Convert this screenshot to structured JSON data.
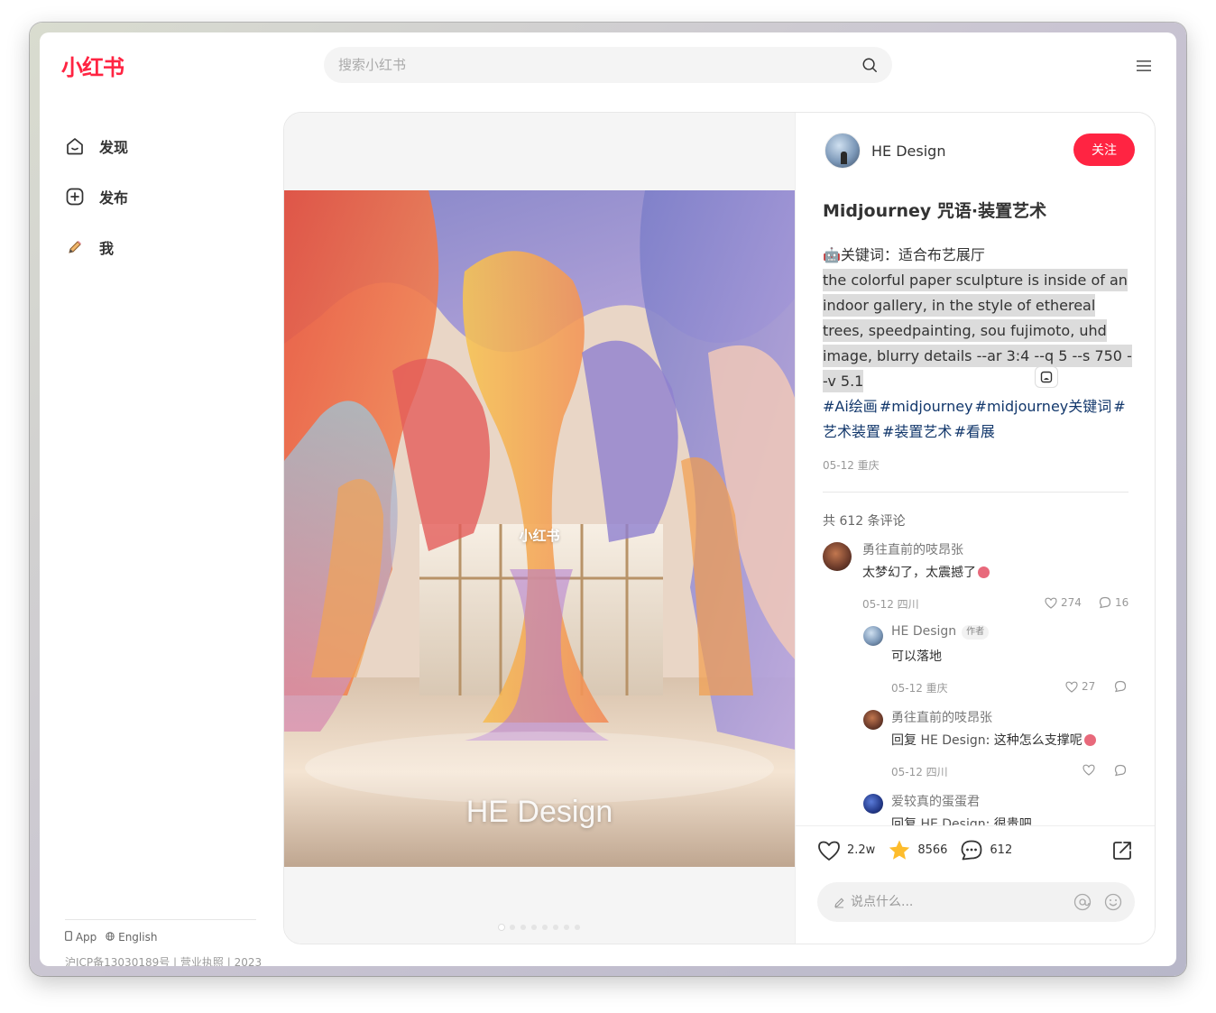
{
  "header": {
    "logo": "小红书",
    "search_placeholder": "搜索小红书"
  },
  "nav": {
    "items": [
      {
        "label": "发现",
        "icon": "home-icon"
      },
      {
        "label": "发布",
        "icon": "plus-square-icon"
      },
      {
        "label": "我",
        "icon": "pencil-avatar-icon"
      }
    ]
  },
  "footer": {
    "app": "App",
    "language": "English",
    "icp": "沪ICP备13030189号 | 营业执照 | 2023"
  },
  "media": {
    "watermark": "小红书",
    "brand_text": "HE Design",
    "image_count": 8,
    "active_index": 0
  },
  "note": {
    "author": "HE Design",
    "follow_label": "关注",
    "title": "Midjourney 咒语·装置艺术",
    "keyword_line": "🤖关键词：适合布艺展厅",
    "prompt": "the colorful paper sculpture is inside of an indoor gallery, in the style of ethereal trees, speedpainting, sou fujimoto, uhd image, blurry details --ar 3:4 --q 5 --s 750 --v 5.1",
    "tags": [
      "#Ai绘画",
      "#midjourney",
      "#midjourney关键词",
      "#艺术装置",
      "#装置艺术",
      "#看展"
    ],
    "date_location": "05-12 重庆",
    "comment_count_text": "共 612 条评论"
  },
  "comments": [
    {
      "name": "勇往直前的吱昂张",
      "text": "太梦幻了，太震撼了",
      "meta": "05-12 四川",
      "likes": "274",
      "replies": "16"
    },
    {
      "name": "HE Design",
      "tag": "作者",
      "text": "可以落地",
      "meta": "05-12 重庆",
      "likes": "27",
      "replies": ""
    },
    {
      "name": "勇往直前的吱昂张",
      "text_prefix": "回复",
      "text_target": "HE Design",
      "text": ": 这种怎么支撑呢",
      "meta": "05-12 四川",
      "likes": "",
      "replies": ""
    },
    {
      "name": "爱较真的蛋蛋君",
      "text_prefix": "回复",
      "text_target": "HE Design",
      "text": ": 很贵吧"
    }
  ],
  "engagement": {
    "likes": "2.2w",
    "collects": "8566",
    "comments": "612",
    "collect_color": "#fdbc2c"
  },
  "comment_input": {
    "placeholder": "说点什么..."
  },
  "colors": {
    "brand": "#ff2442",
    "tag": "#13386c"
  }
}
